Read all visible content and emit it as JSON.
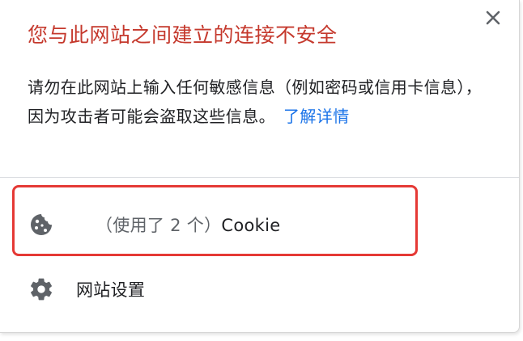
{
  "dialog": {
    "title": "您与此网站之间建立的连接不安全",
    "description": "请勿在此网站上输入任何敏感信息（例如密码或信用卡信息），因为攻击者可能会盗取这些信息。",
    "learn_more_link": "了解详情",
    "close_icon": "close-icon"
  },
  "items": {
    "cookies": {
      "prefix": "（使用了 2 个）",
      "label": "Cookie",
      "icon": "cookie-icon"
    },
    "site_settings": {
      "label": "网站设置",
      "icon": "gear-icon"
    }
  },
  "colors": {
    "title": "#c5392d",
    "link": "#1a73e8",
    "highlight": "#e53935",
    "icon": "#5f6368"
  }
}
